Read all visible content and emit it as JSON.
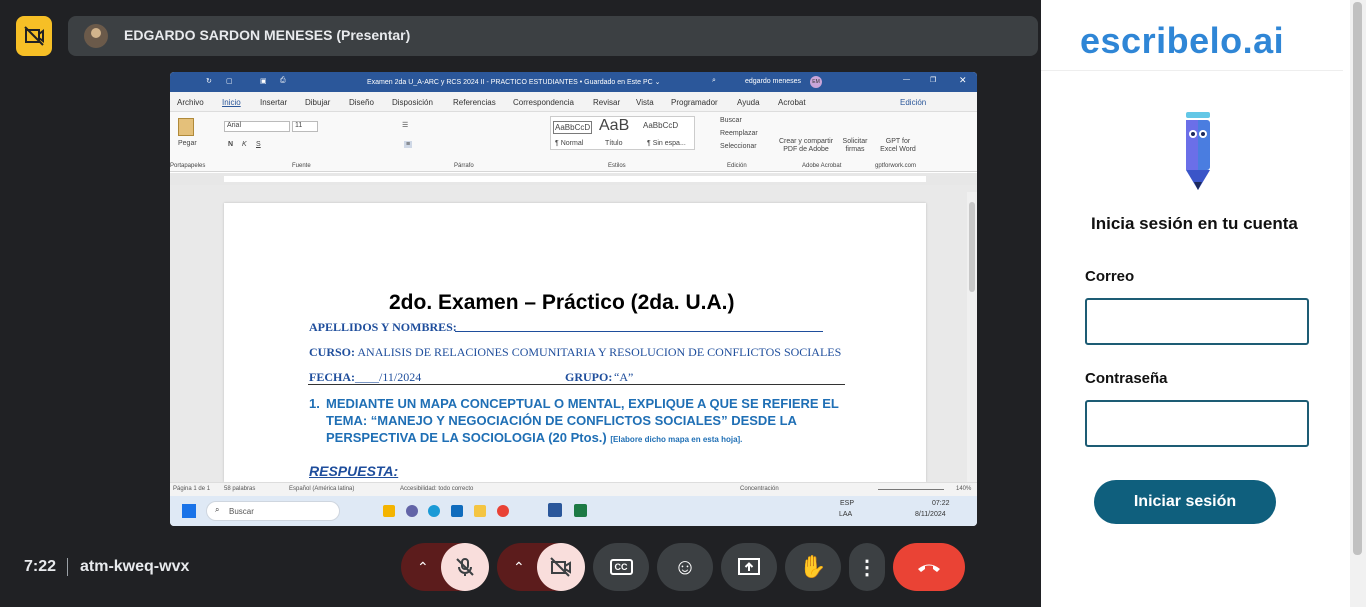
{
  "meet": {
    "presenter_name": "EDGARDO SARDON MENESES (Presentar)",
    "time": "7:22",
    "meeting_code": "atm-kweq-wvx"
  },
  "word": {
    "title": "Examen 2da U_A-ARC y RCS 2024 II - PRACTICO ESTUDIANTES • Guardado en Este PC ⌄",
    "user": "edgardo meneses",
    "user_initials": "EM",
    "tabs": [
      "Archivo",
      "Inicio",
      "Insertar",
      "Dibujar",
      "Diseño",
      "Disposición",
      "Referencias",
      "Correspondencia",
      "Revisar",
      "Vista",
      "Programador",
      "Ayuda",
      "Acrobat"
    ],
    "edit_mode": "Edición",
    "font": "Arial",
    "font_size": "11",
    "ribbon": {
      "paste": "Pegar",
      "styles": [
        "AaBbCcD",
        "AaB",
        "AaBbCcD"
      ],
      "style_names": [
        "¶ Normal",
        "Título",
        "¶ Sin espa..."
      ],
      "search": "Buscar",
      "replace": "Reemplazar",
      "select": "Seleccionar",
      "adobe": "Crear y compartir PDF de Adobe",
      "sign": "Solicitar firmas",
      "gpt": "GPT for Excel Word",
      "groups": [
        "Portapapeles",
        "Fuente",
        "Párrafo",
        "Estilos",
        "Edición",
        "Adobe Acrobat",
        "gptforwork.com"
      ]
    },
    "doc": {
      "heading": "2do. Examen – Práctico (2da. U.A.)",
      "apellidos_label": "APELLIDOS Y NOMBRES:",
      "curso_label": "CURSO:",
      "curso_value": "ANALISIS DE RELACIONES COMUNITARIA Y RESOLUCION DE CONFLICTOS SOCIALES",
      "fecha_label": "FECHA:",
      "fecha_value": "____/11/2024",
      "grupo_label": "GRUPO:",
      "grupo_value": "“A”",
      "q_number": "1.",
      "q_line1": "MEDIANTE UN MAPA CONCEPTUAL O MENTAL, EXPLIQUE A QUE SE REFIERE EL",
      "q_line2": "TEMA: “MANEJO Y NEGOCIACIÓN DE CONFLICTOS SOCIALES” DESDE LA",
      "q_line3": "PERSPECTIVA DE LA SOCIOLOGIA (20 Ptos.)",
      "q_note": "[Elabore dicho mapa en esta hoja].",
      "respuesta": "RESPUESTA:"
    },
    "status": {
      "page": "Página 1 de 1",
      "words": "58 palabras",
      "lang": "Español (América latina)",
      "accessibility": "Accesibilidad: todo correcto",
      "focus": "Concentración",
      "zoom": "140%"
    }
  },
  "taskbar": {
    "search_placeholder": "Buscar",
    "lang": "ESP",
    "lang2": "LAA",
    "clock": "07:22",
    "date": "8/11/2024"
  },
  "login": {
    "brand": "escribelo.ai",
    "title": "Inicia sesión en tu cuenta",
    "email_label": "Correo",
    "password_label": "Contraseña",
    "submit": "Iniciar sesión"
  },
  "colors": {
    "meet_bg": "#202124",
    "hangup": "#ea4335",
    "muted": "#f9dedc",
    "brand": "#2f86d6",
    "login_btn": "#0f5f7d"
  }
}
